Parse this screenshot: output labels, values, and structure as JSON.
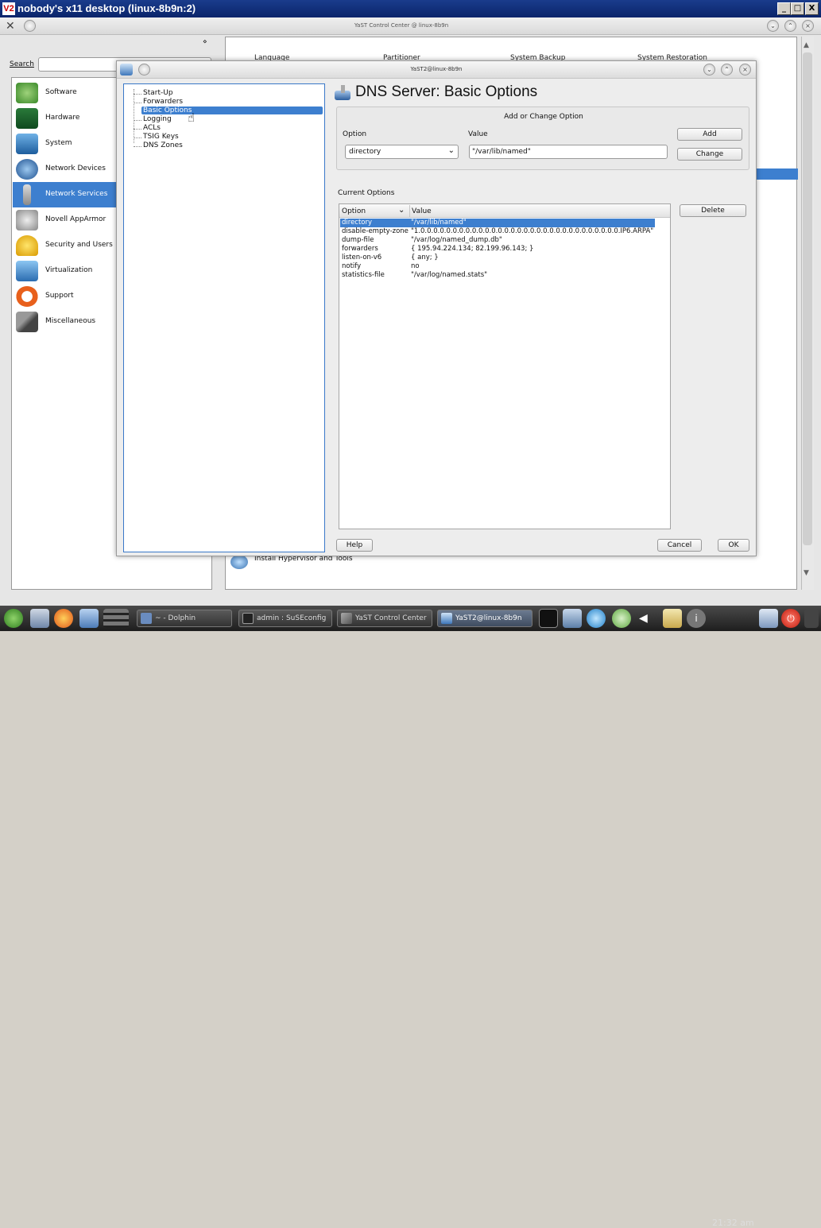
{
  "vnc": {
    "title": "nobody's x11 desktop (linux-8b9n:2)",
    "logo": "V2",
    "min": "_",
    "max": "□",
    "close": "X"
  },
  "yast_cc": {
    "title": "YaST Control Center @ linux-8b9n",
    "search_label": "Search",
    "categories": [
      {
        "label": "Software",
        "icon": "software-icon"
      },
      {
        "label": "Hardware",
        "icon": "hardware-icon"
      },
      {
        "label": "System",
        "icon": "system-icon"
      },
      {
        "label": "Network Devices",
        "icon": "network-devices-icon"
      },
      {
        "label": "Network Services",
        "icon": "network-services-icon"
      },
      {
        "label": "Novell AppArmor",
        "icon": "apparmor-icon"
      },
      {
        "label": "Security and Users",
        "icon": "security-icon"
      },
      {
        "label": "Virtualization",
        "icon": "virtualization-icon"
      },
      {
        "label": "Support",
        "icon": "support-icon"
      },
      {
        "label": "Miscellaneous",
        "icon": "miscellaneous-icon"
      }
    ],
    "selected_category": "Network Services",
    "module_row": [
      "Language",
      "Partitioner",
      "System Backup",
      "System Restoration"
    ],
    "install_hv": "Install Hypervisor and Tools"
  },
  "dialog": {
    "title": "YaST2@linux-8b9n",
    "tree": [
      "Start-Up",
      "Forwarders",
      "Basic Options",
      "Logging",
      "ACLs",
      "TSIG Keys",
      "DNS Zones"
    ],
    "tree_selected": "Basic Options",
    "heading": "DNS Server: Basic Options",
    "add_change_title": "Add or Change Option",
    "option_label": "Option",
    "value_label": "Value",
    "option_selected": "directory",
    "value_input": "\"/var/lib/named\"",
    "add_btn": "Add",
    "change_btn": "Change",
    "current_options_label": "Current Options",
    "delete_btn": "Delete",
    "table_headers": [
      "Option",
      "Value"
    ],
    "rows": [
      {
        "option": "directory",
        "value": "\"/var/lib/named\""
      },
      {
        "option": "disable-empty-zone",
        "value": "\"1.0.0.0.0.0.0.0.0.0.0.0.0.0.0.0.0.0.0.0.0.0.0.0.0.0.0.0.0.0.0.0.IP6.ARPA\""
      },
      {
        "option": "dump-file",
        "value": "\"/var/log/named_dump.db\""
      },
      {
        "option": "forwarders",
        "value": "{ 195.94.224.134; 82.199.96.143; }"
      },
      {
        "option": "listen-on-v6",
        "value": "{ any; }"
      },
      {
        "option": "notify",
        "value": "no"
      },
      {
        "option": "statistics-file",
        "value": "\"/var/log/named.stats\""
      }
    ],
    "selected_row": 0,
    "help_btn": "Help",
    "cancel_btn": "Cancel",
    "ok_btn": "OK"
  },
  "taskbar": {
    "tasks": [
      "~ - Dolphin",
      "admin : SuSEconfig",
      "YaST Control Center",
      "YaST2@linux-8b9n"
    ],
    "active_task": "YaST2@linux-8b9n",
    "clock": "21:32 am"
  }
}
